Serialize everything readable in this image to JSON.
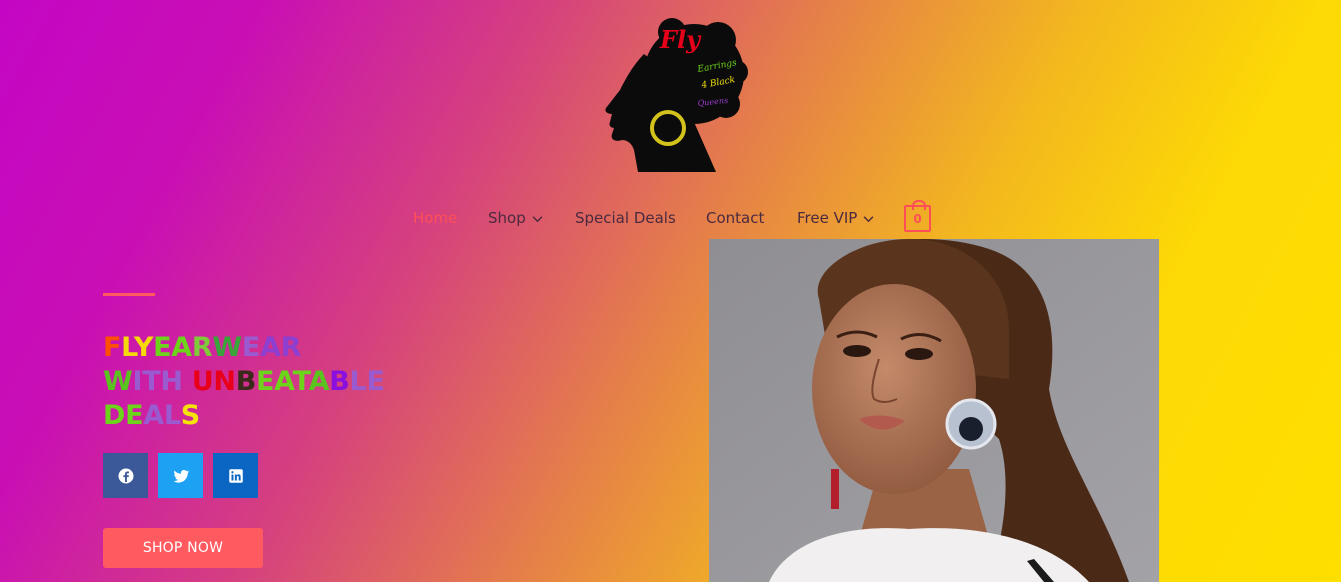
{
  "brand": {
    "logo_text_main": "Fly",
    "logo_text_sub1": "Earrings",
    "logo_text_sub2": "4 Black",
    "logo_text_sub3": "Queens"
  },
  "nav": {
    "items": [
      {
        "label": "Home",
        "active": true,
        "has_dropdown": false
      },
      {
        "label": "Shop",
        "active": false,
        "has_dropdown": true
      },
      {
        "label": "Special Deals",
        "active": false,
        "has_dropdown": false
      },
      {
        "label": "Contact",
        "active": false,
        "has_dropdown": false
      },
      {
        "label": "Free VIP",
        "active": false,
        "has_dropdown": true
      }
    ],
    "cart_count": "0"
  },
  "hero": {
    "headline_lines": [
      [
        {
          "t": "F",
          "c": "#ff4f00"
        },
        {
          "t": "L",
          "c": "#f5d90a"
        },
        {
          "t": "Y",
          "c": "#f5d90a"
        },
        {
          "t": "E",
          "c": "#6dd41c"
        },
        {
          "t": "A",
          "c": "#6dd41c"
        },
        {
          "t": "R",
          "c": "#7fc93a"
        },
        {
          "t": "W",
          "c": "#3aa33a"
        },
        {
          "t": "E",
          "c": "#9a5bd0"
        },
        {
          "t": "A",
          "c": "#8c3fd0"
        },
        {
          "t": "R",
          "c": "#8c3fd0"
        }
      ],
      [
        {
          "t": "W",
          "c": "#5ac41e"
        },
        {
          "t": "I",
          "c": "#9a5bd0"
        },
        {
          "t": "T",
          "c": "#9a5bd0"
        },
        {
          "t": "H",
          "c": "#9a5bd0"
        },
        {
          "t": " ",
          "c": "#000"
        },
        {
          "t": "U",
          "c": "#e8001b"
        },
        {
          "t": "N",
          "c": "#e8001b"
        },
        {
          "t": "B",
          "c": "#3a2a1a"
        },
        {
          "t": "E",
          "c": "#6dd41c"
        },
        {
          "t": "A",
          "c": "#6dd41c"
        },
        {
          "t": "T",
          "c": "#6dd41c"
        },
        {
          "t": "A",
          "c": "#5ac41e"
        },
        {
          "t": "B",
          "c": "#8a10e0"
        },
        {
          "t": "L",
          "c": "#9a5bd0"
        },
        {
          "t": "E",
          "c": "#9a5bd0"
        }
      ],
      [
        {
          "t": "D",
          "c": "#6dd41c"
        },
        {
          "t": "E",
          "c": "#6dd41c"
        },
        {
          "t": "A",
          "c": "#9a5bd0"
        },
        {
          "t": "L",
          "c": "#9a5bd0"
        },
        {
          "t": "S",
          "c": "#f5e20a"
        }
      ]
    ],
    "social": [
      {
        "name": "facebook",
        "bg": "#3b5998"
      },
      {
        "name": "twitter",
        "bg": "#1da1f2"
      },
      {
        "name": "linkedin",
        "bg": "#0a66c2"
      }
    ],
    "cta_label": "SHOP NOW"
  },
  "colors": {
    "accent": "#ff5a5f",
    "gradient_start": "#c406c4",
    "gradient_end": "#fedf00"
  }
}
